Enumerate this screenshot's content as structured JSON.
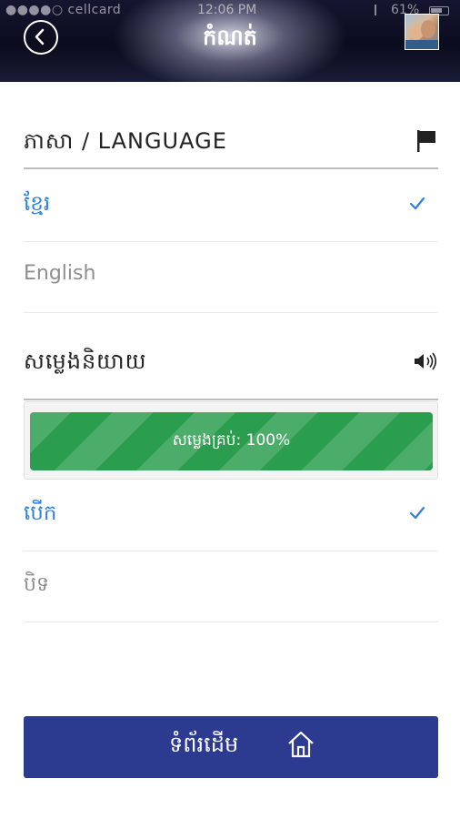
{
  "status_bar": {
    "carrier": "●●●●○ cellcard",
    "time": "12:06 PM",
    "battery": "61%"
  },
  "header": {
    "title": "កំណត់",
    "back_icon": "chevron-left-circle-icon",
    "avatar_icon": "user-avatar"
  },
  "language_section": {
    "title": "ភាសា / LANGUAGE",
    "icon": "flag-icon",
    "options": [
      {
        "label": "ខ្មែរ",
        "selected": true
      },
      {
        "label": "English",
        "selected": false
      }
    ]
  },
  "voice_section": {
    "title": "សម្លេងនិយាយ",
    "icon": "speaker-icon",
    "volume_progress": {
      "label": "សម្លេងគ្រប់: 100%",
      "value": 1.0
    },
    "options": [
      {
        "label": "បើក",
        "selected": true
      },
      {
        "label": "បិទ",
        "selected": false
      }
    ]
  },
  "home_button": {
    "label": "ទំព័រដើម",
    "icon": "home-icon"
  },
  "colors": {
    "accent_blue": "#2f7fe0",
    "progress_green": "#2a9d4e",
    "home_button_bg": "#2c3a8f"
  }
}
